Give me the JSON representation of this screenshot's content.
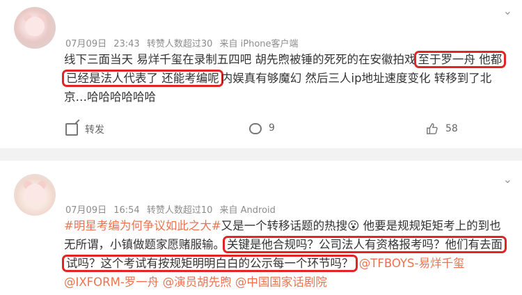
{
  "posts": [
    {
      "meta": {
        "date": "07月09日",
        "time": "23:43",
        "reposts": "转赞人数超过30",
        "source": "来自 iPhone客户端"
      },
      "lines": [
        {
          "a": "线下三面当天 易烊千玺在录制五四吧 胡先煦被锤的死死的在安徽拍戏",
          "hl": "至于罗一舟 他都"
        },
        {
          "hl": "已经是法人代表了 还能考编呢",
          "a": "内娱真有够魔幻 然后三人ip地址速度变化 转移到了北"
        },
        {
          "a": "京…哈哈哈哈哈哈"
        }
      ],
      "actions": {
        "share": "转发",
        "comments": "9",
        "likes": "58"
      }
    },
    {
      "meta": {
        "date": "07月09日",
        "time": "16:54",
        "reposts": "转赞人数超过10",
        "source": "来自 Android"
      },
      "l1_topic": "#明星考编为何争议如此之大#",
      "l1_rest": "又是一个转移话题的热搜😮 他要是规规矩矩考上的到也",
      "l2_a": "无所谓，小镇做题家愿赌服输。",
      "l2_hl": "关键是他合规吗？公司法人有资格报考吗？他们有去面",
      "l3_hl": "试吗？这个考试有按规矩明明白白的公示每一个环节吗？",
      "l3_mention": "@TFBOYS-易烊千玺",
      "l4_m1": "@IXFORM-罗一舟",
      "l4_m2": "@演员胡先煦",
      "l4_m3": "@中国国家话剧院",
      "more": "⌄"
    }
  ],
  "more_icon": "⌄"
}
